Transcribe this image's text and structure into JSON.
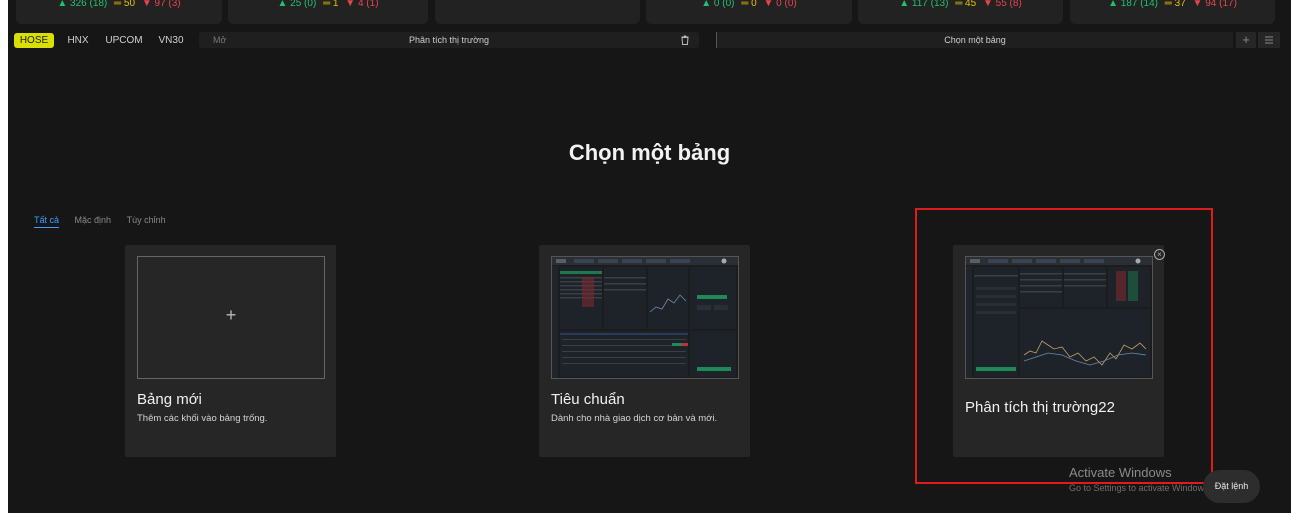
{
  "ticker": [
    {
      "up": "326 (18)",
      "ref": "50",
      "down": "97 (3)"
    },
    {
      "up": "25 (0)",
      "ref": "1",
      "down": "4 (1)"
    },
    {
      "up": "",
      "ref": "",
      "down": ""
    },
    {
      "up": "0 (0)",
      "ref": "0",
      "down": "0 (0)"
    },
    {
      "up": "117 (13)",
      "ref": "45",
      "down": "55 (8)"
    },
    {
      "up": "187 (14)",
      "ref": "37",
      "down": "94 (17)"
    }
  ],
  "exchanges": [
    "HOSE",
    "HNX",
    "UPCOM",
    "VN30"
  ],
  "toolbar": {
    "open_label": "Mở",
    "current_board": "Phân tích thị trường",
    "select_board": "Chọn một bảng",
    "add_label": "+"
  },
  "page_title": "Chọn một bảng",
  "filters": [
    "Tất cả",
    "Mặc định",
    "Tùy chỉnh"
  ],
  "cards": [
    {
      "title": "Bảng mới",
      "desc": "Thêm các khối vào bảng trống.",
      "plus": "+"
    },
    {
      "title": "Tiêu chuẩn",
      "desc": "Dành cho nhà giao dịch cơ bản và mới."
    },
    {
      "title": "Phân tích thị trường22",
      "desc": "",
      "remove": "×"
    }
  ],
  "watermark": {
    "title": "Activate Windows",
    "subtitle": "Go to Settings to activate Windows."
  },
  "order_button": "Đặt lệnh",
  "colors": {
    "accent": "#d9e000",
    "highlight": "#e01b1b",
    "link": "#39a0ff"
  }
}
